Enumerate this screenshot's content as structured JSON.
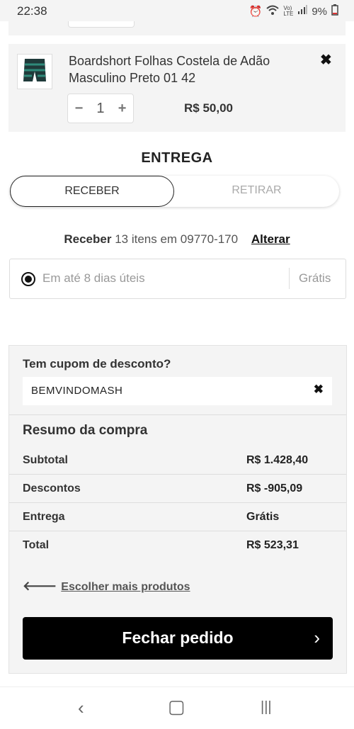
{
  "status_bar": {
    "time": "22:38",
    "battery": "9%",
    "icons": [
      "alarm-icon",
      "wifi-icon",
      "volte-icon",
      "signal-icon",
      "battery-icon"
    ],
    "volte_text": "Vo) LTE"
  },
  "cart_item": {
    "name": "Boardshort Folhas Costela de Adão Masculino Preto 01 42",
    "quantity": "1",
    "price": "R$ 50,00",
    "minus": "−",
    "plus": "+",
    "remove": "✖"
  },
  "delivery": {
    "title": "ENTREGA",
    "tab_receive": "RECEBER",
    "tab_pickup": "RETIRAR",
    "receive_bold": "Receber",
    "receive_info": "13 itens em 09770-170",
    "change_link": "Alterar",
    "option_label": "Em até 8 dias úteis",
    "option_price": "Grátis"
  },
  "coupon": {
    "title": "Tem cupom de desconto?",
    "code": "BEMVINDOMASH",
    "clear": "✖"
  },
  "summary": {
    "title": "Resumo da compra",
    "rows": [
      {
        "label": "Subtotal",
        "value": "R$ 1.428,40"
      },
      {
        "label": "Descontos",
        "value": "R$ -905,09"
      },
      {
        "label": "Entrega",
        "value": "Grátis"
      },
      {
        "label": "Total",
        "value": "R$ 523,31"
      }
    ],
    "more_products": "Escolher mais produtos",
    "checkout": "Fechar pedido"
  },
  "navbar": {
    "back": "‹",
    "home": "▢",
    "recents": "|||"
  }
}
